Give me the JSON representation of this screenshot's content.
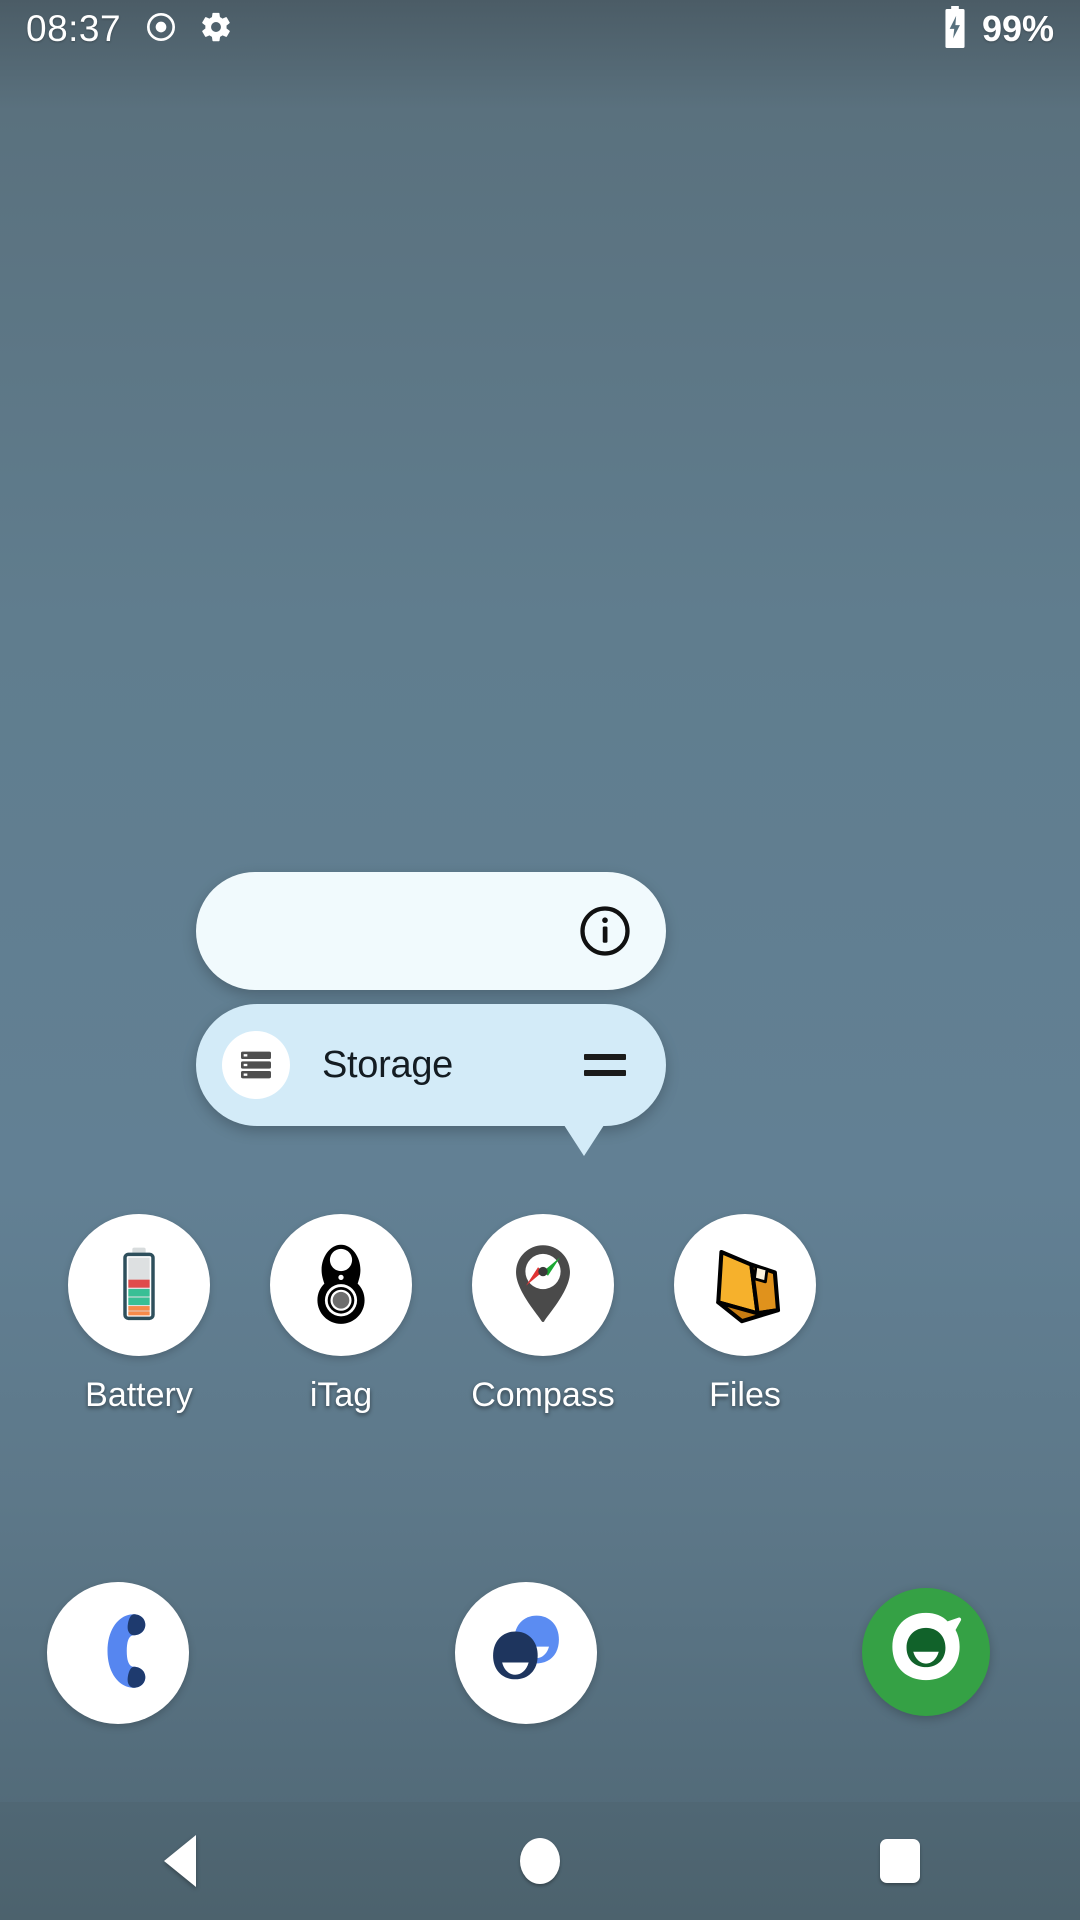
{
  "status_bar": {
    "clock": "08:37",
    "left_icons": [
      {
        "name": "record-dot-icon",
        "glyph": "record"
      },
      {
        "name": "gear-icon",
        "glyph": "gear"
      }
    ],
    "battery_percent": "99%",
    "battery_state": "charging",
    "icon_color": "#ffffff"
  },
  "popup": {
    "info_bubble": {
      "background": "#f1fafd",
      "info_icon": "info-circle-icon",
      "label": ""
    },
    "storage_bubble": {
      "background": "#d3ebf8",
      "icon": "storage-server-icon",
      "label": "Storage",
      "drag_handle": "equals-drag-handle-icon"
    }
  },
  "app_row": [
    {
      "label": "Battery",
      "icon": "battery-icon"
    },
    {
      "label": "iTag",
      "icon": "itag-keyfob-icon"
    },
    {
      "label": "Compass",
      "icon": "compass-pin-icon"
    },
    {
      "label": "Files",
      "icon": "files-folder-icon"
    }
  ],
  "dock": [
    {
      "name": "phone",
      "icon": "phone-handset-icon",
      "color": "#4d7cf0"
    },
    {
      "name": "contacts",
      "icon": "two-faces-icon",
      "color": "#1e355e"
    },
    {
      "name": "green-app",
      "icon": "green-smiley-leaf-icon",
      "color": "#35a145"
    }
  ],
  "nav_bar": {
    "back": "back-triangle",
    "home": "home-circle",
    "recents": "recents-square"
  },
  "wallpaper": {
    "top_color": "#4b5c66",
    "mid_color": "#628094",
    "bottom_color": "#4f6672"
  }
}
